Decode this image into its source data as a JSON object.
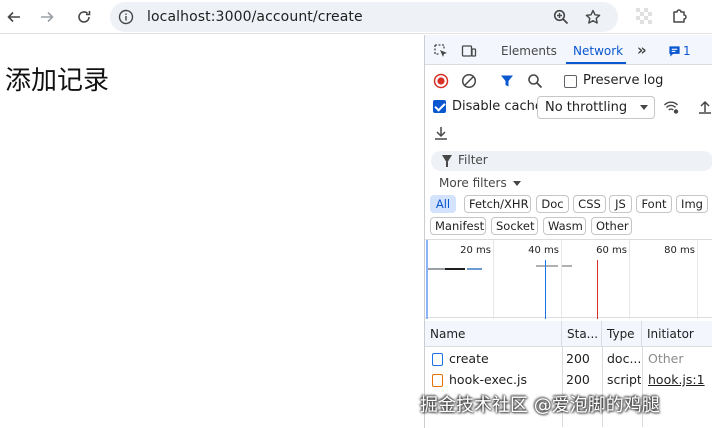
{
  "browser": {
    "url": "localhost:3000/account/create",
    "icons": [
      "back-icon",
      "forward-icon",
      "reload-icon",
      "info-icon",
      "zoom-icon",
      "star-icon",
      "extension-icon",
      "puzzle-icon"
    ]
  },
  "page": {
    "title": "添加记录"
  },
  "devtools": {
    "tabs": {
      "elements": "Elements",
      "network": "Network",
      "more": "»",
      "issues_count": "1"
    },
    "toolbar": {
      "preserve_log": "Preserve log",
      "preserve_log_checked": false,
      "disable_cache": "Disable cache",
      "disable_cache_checked": true,
      "throttling": "No throttling"
    },
    "filter": {
      "placeholder": "Filter",
      "more_filters": "More filters"
    },
    "type_filters": [
      "All",
      "Fetch/XHR",
      "Doc",
      "CSS",
      "JS",
      "Font",
      "Img",
      "Manifest",
      "Socket",
      "Wasm",
      "Other"
    ],
    "active_type_filter": "All",
    "timeline": {
      "ticks": [
        "20 ms",
        "40 ms",
        "60 ms",
        "80 ms"
      ]
    },
    "table": {
      "headers": [
        "Name",
        "Sta...",
        "Type",
        "Initiator"
      ],
      "rows": [
        {
          "name": "create",
          "status": "200",
          "type": "doc...",
          "initiator": "Other",
          "icon": "document-icon"
        },
        {
          "name": "hook-exec.js",
          "status": "200",
          "type": "script",
          "initiator": "hook.js:1",
          "icon": "script-icon"
        }
      ]
    },
    "colors": {
      "accent": "#0b57d0",
      "record_red": "#d93025",
      "doc_blue": "#1a73e8",
      "script_orange": "#e8710a"
    }
  },
  "watermark": "掘金技术社区 @爱泡脚的鸡腿"
}
